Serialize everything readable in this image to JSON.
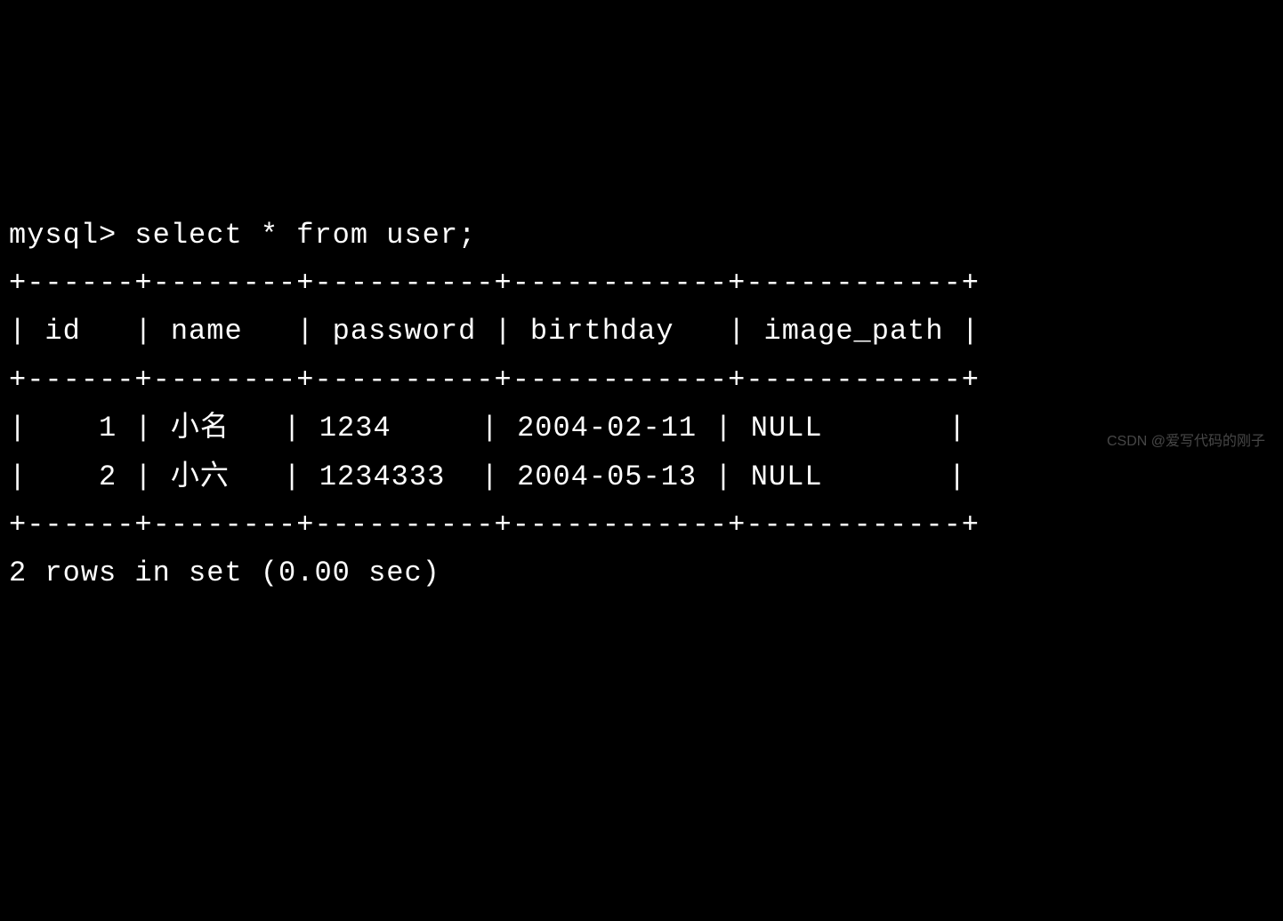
{
  "terminal": {
    "prompt": "mysql> ",
    "command": "select * from user;",
    "border_top": "+------+--------+----------+------------+------------+",
    "header_row": "| id   | name   | password | birthday   | image_path |",
    "border_mid": "+------+--------+----------+------------+------------+",
    "data_row_1": "|    1 | 小名   | 1234     | 2004-02-11 | NULL       |",
    "data_row_2": "|    2 | 小六   | 1234333  | 2004-05-13 | NULL       |",
    "border_bottom": "+------+--------+----------+------------+------------+",
    "status": "2 rows in set (0.00 sec)"
  },
  "chart_data": {
    "type": "table",
    "columns": [
      "id",
      "name",
      "password",
      "birthday",
      "image_path"
    ],
    "rows": [
      {
        "id": 1,
        "name": "小名",
        "password": "1234",
        "birthday": "2004-02-11",
        "image_path": "NULL"
      },
      {
        "id": 2,
        "name": "小六",
        "password": "1234333",
        "birthday": "2004-05-13",
        "image_path": "NULL"
      }
    ],
    "row_count": 2,
    "query_time_sec": 0.0
  },
  "watermark": "CSDN @爱写代码的刚子"
}
